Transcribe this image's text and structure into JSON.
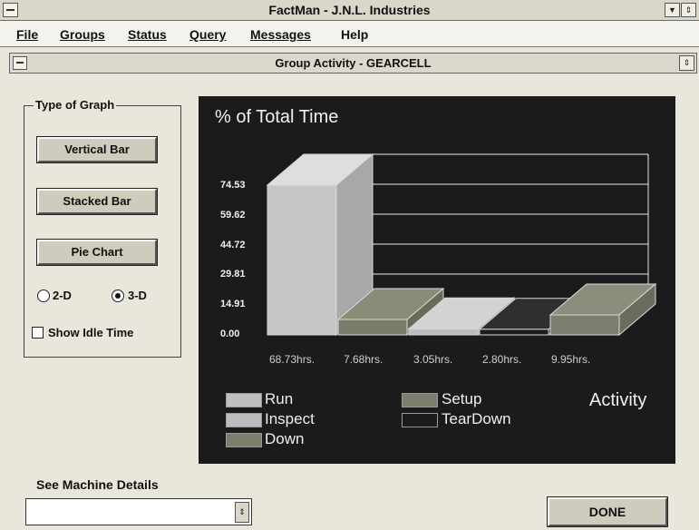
{
  "window": {
    "title": "FactMan - J.N.L. Industries"
  },
  "menu": {
    "items": [
      "File",
      "Groups",
      "Status",
      "Query",
      "Messages",
      "Help"
    ]
  },
  "child_window": {
    "title": "Group Activity - GEARCELL"
  },
  "graph_type": {
    "group_label": "Type of Graph",
    "buttons": [
      "Vertical Bar",
      "Stacked Bar",
      "Pie Chart"
    ],
    "radio_2d": "2-D",
    "radio_3d": "3-D",
    "selected": "3-D",
    "show_idle_label": "Show Idle Time",
    "show_idle_checked": false
  },
  "chart_data": {
    "type": "bar",
    "three_d": true,
    "title": "% of Total Time",
    "yticks": [
      "74.53",
      "59.62",
      "44.72",
      "29.81",
      "14.91",
      "0.00"
    ],
    "ylim": [
      0,
      74.53
    ],
    "categories": [
      "Run",
      "Setup",
      "Inspect",
      "TearDown",
      "Down"
    ],
    "values": [
      74.53,
      7.68,
      3.05,
      2.8,
      9.95
    ],
    "hours_labels": [
      "68.73hrs.",
      "7.68hrs.",
      "3.05hrs.",
      "2.80hrs.",
      "9.95hrs."
    ],
    "colors": [
      "#c6c6c6",
      "#7a7d6a",
      "#bcbcbc",
      "#1b1b1b",
      "#7b7f6e"
    ],
    "legend": [
      {
        "label": "Run",
        "color": "#bfbfbf"
      },
      {
        "label": "Setup",
        "color": "#7b7f6e"
      },
      {
        "label": "Inspect",
        "color": "#bcbcbc"
      },
      {
        "label": "TearDown",
        "color": "#1b1b1b"
      },
      {
        "label": "Down",
        "color": "#7b7f6e"
      }
    ],
    "legend_title": "Activity",
    "grid": true
  },
  "details": {
    "see_label": "See Machine Details",
    "combo_value": "",
    "done_label": "DONE"
  }
}
